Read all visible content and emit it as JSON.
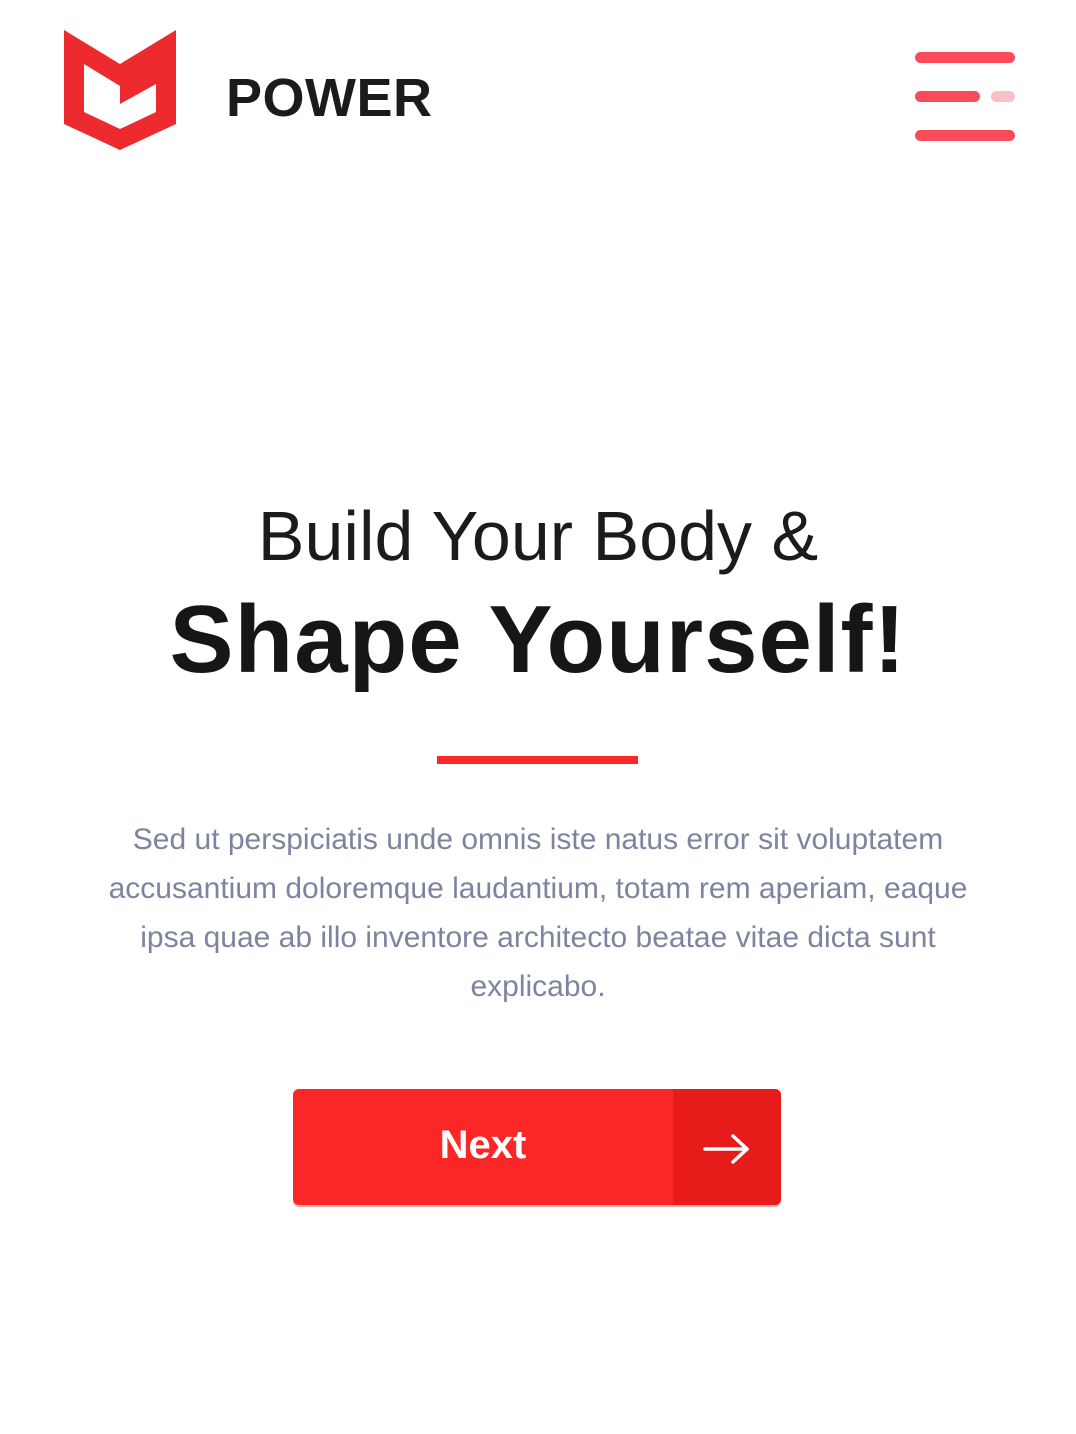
{
  "header": {
    "brand_name": "POWER",
    "logo_icon": "power-shield-logo-icon",
    "menu_icon": "hamburger-menu-icon"
  },
  "hero": {
    "line1": "Build Your Body &",
    "line2": "Shape Yourself!",
    "description": "Sed ut perspiciatis unde omnis iste natus error sit voluptatem accusantium doloremque laudantium, totam rem aperiam, eaque ipsa quae ab illo inventore architecto beatae vitae dicta sunt explicabo."
  },
  "cta": {
    "next_label": "Next",
    "arrow_icon": "arrow-right-icon"
  },
  "colors": {
    "accent_red": "#fb2626",
    "accent_red_dark": "#e81b1b",
    "menu_pink": "#fb4b5b",
    "menu_pink_light": "#fbc0c6",
    "text_dark": "#1b1b1b",
    "text_muted": "#7c84a0"
  }
}
